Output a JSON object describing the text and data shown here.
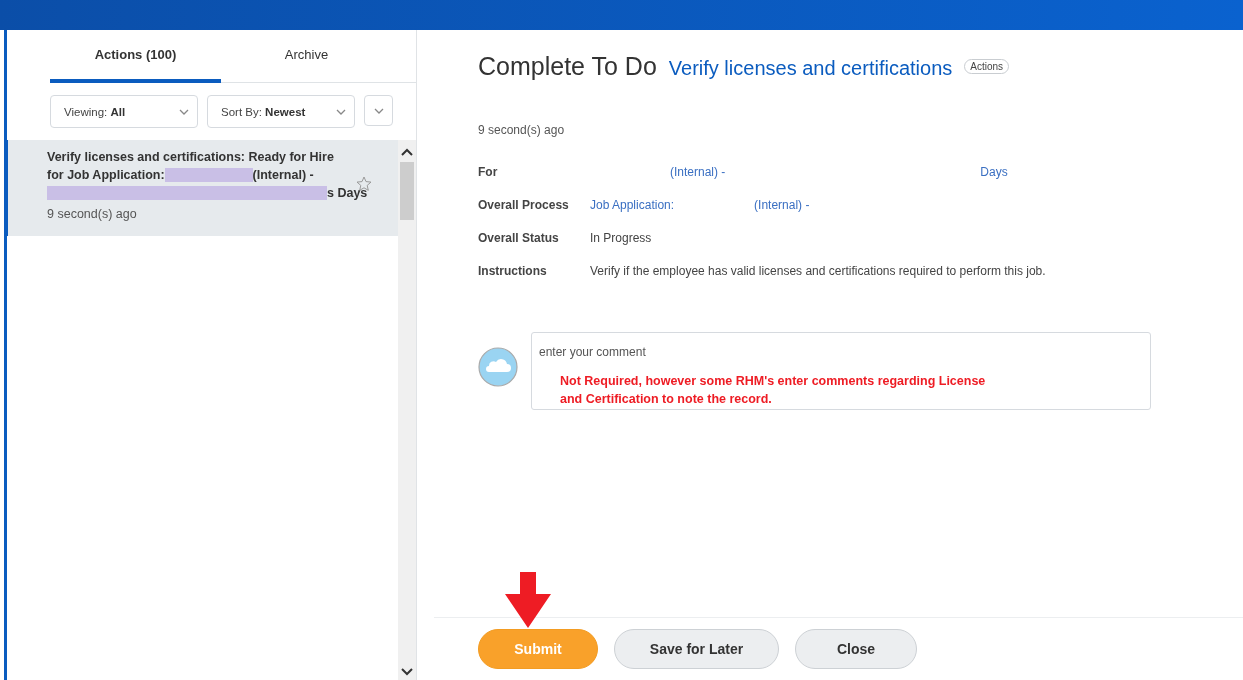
{
  "tabs": [
    {
      "label": "Actions (100)",
      "selected": true
    },
    {
      "label": "Archive",
      "selected": false
    }
  ],
  "filters": [
    {
      "label": "Viewing:",
      "value": "All"
    },
    {
      "label": "Sort By:",
      "value": "Newest"
    }
  ],
  "inbox_items": [
    {
      "selected": true,
      "starred": false,
      "lines": [
        [
          {
            "kind": "text",
            "text": "Verify licenses and certifications: Ready for Hire"
          }
        ],
        [
          {
            "kind": "text",
            "text": "for Job Application:"
          },
          {
            "kind": "redaction"
          },
          {
            "kind": "text",
            "text": "(Internal) -"
          }
        ],
        [
          {
            "kind": "redaction"
          },
          {
            "kind": "text",
            "text": "s Days"
          }
        ]
      ],
      "time": "9 second(s) ago"
    }
  ],
  "header": {
    "title": "Complete To Do",
    "subject": "Verify licenses and certifications",
    "actions_label": "Actions"
  },
  "timestamp": "9 second(s) ago",
  "fields": [
    {
      "label": "For",
      "segments": [
        {
          "kind": "gap"
        },
        {
          "kind": "link",
          "text": "(Internal) -"
        },
        {
          "kind": "gap"
        },
        {
          "kind": "link",
          "text": "Days"
        }
      ]
    },
    {
      "label": "Overall Process",
      "segments": [
        {
          "kind": "link",
          "text": "Job Application:"
        },
        {
          "kind": "gap"
        },
        {
          "kind": "link",
          "text": "(Internal) -"
        }
      ]
    },
    {
      "label": "Overall Status",
      "segments": [
        {
          "kind": "text",
          "text": "In Progress"
        }
      ]
    },
    {
      "label": "Instructions",
      "segments": [
        {
          "kind": "text",
          "text": "Verify if the employee has valid licenses and certifications required to perform this job."
        }
      ]
    }
  ],
  "comment": {
    "placeholder": "enter your comment",
    "annotation": "Not Required, however some RHM's enter comments regarding License and Certification to note the record."
  },
  "buttons": [
    {
      "label": "Submit",
      "kind": "primary"
    },
    {
      "label": "Save for Later",
      "kind": "secondary"
    },
    {
      "label": "Close",
      "kind": "secondary"
    }
  ]
}
